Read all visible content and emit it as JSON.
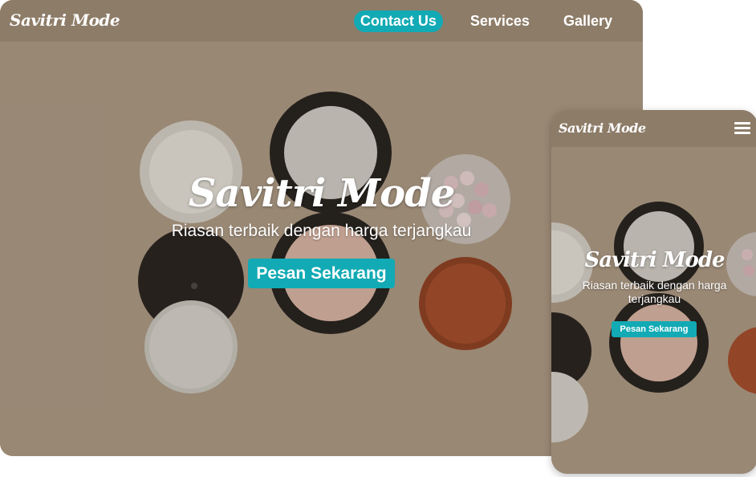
{
  "site": {
    "logo": "Savitri Mode"
  },
  "nav": {
    "items": [
      {
        "label": "Contact Us",
        "active": true
      },
      {
        "label": "Services",
        "active": false
      },
      {
        "label": "Gallery",
        "active": false
      }
    ],
    "menu_icon": "hamburger-icon"
  },
  "hero": {
    "title": "Savitri Mode",
    "subtitle": "Riasan terbaik dengan harga terjangkau",
    "cta_label": "Pesan Sekarang",
    "background_image": "cosmetic compacts and powder cases on beige surface"
  },
  "colors": {
    "accent": "#12aab4",
    "background_beige": "#a79682",
    "text": "#ffffff"
  }
}
